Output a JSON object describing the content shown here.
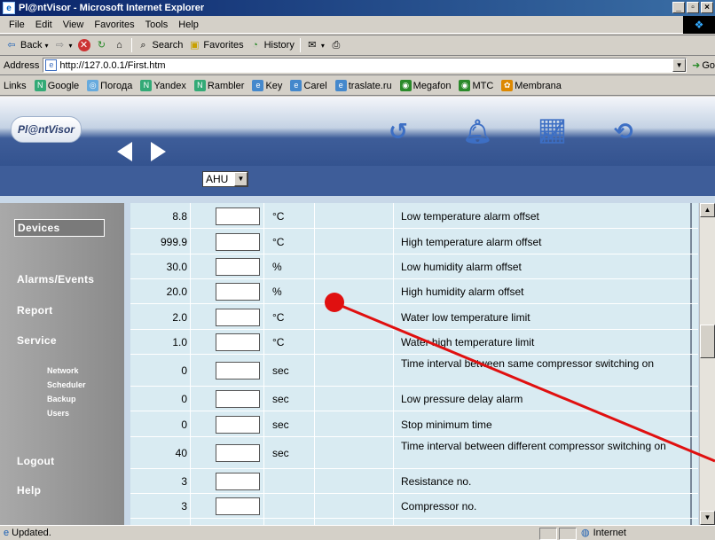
{
  "window": {
    "title": "Pl@ntVisor - Microsoft Internet Explorer"
  },
  "menu": [
    "File",
    "Edit",
    "View",
    "Favorites",
    "Tools",
    "Help"
  ],
  "toolbar": {
    "back": "Back",
    "search": "Search",
    "favorites": "Favorites",
    "history": "History"
  },
  "address": {
    "label": "Address",
    "url": "http://127.0.0.1/First.htm",
    "go": "Go"
  },
  "links": {
    "label": "Links",
    "items": [
      "Google",
      "Погода",
      "Yandex",
      "Rambler",
      "Key",
      "Carel",
      "traslate.ru",
      "Megafon",
      "MTC",
      "Membrana"
    ]
  },
  "plantvisor": {
    "logo": "Pl@ntVisor",
    "device_select": "AHU"
  },
  "sidebar": {
    "items": [
      "Devices",
      "Alarms/Events",
      "Report",
      "Service",
      "Logout",
      "Help"
    ],
    "service_sub": [
      "Network",
      "Scheduler",
      "Backup",
      "Users"
    ]
  },
  "rows": [
    {
      "value": "8.8",
      "unit": "°C",
      "desc": "Low temperature alarm offset"
    },
    {
      "value": "999.9",
      "unit": "°C",
      "desc": "High temperature alarm offset"
    },
    {
      "value": "30.0",
      "unit": "%",
      "desc": "Low humidity alarm offset"
    },
    {
      "value": "20.0",
      "unit": "%",
      "desc": "High humidity alarm offset"
    },
    {
      "value": "2.0",
      "unit": "°C",
      "desc": "Water low temperature limit"
    },
    {
      "value": "1.0",
      "unit": "°C",
      "desc": "Water high temperature limit"
    },
    {
      "value": "0",
      "unit": "sec",
      "desc": "Time interval between same compressor switching on"
    },
    {
      "value": "0",
      "unit": "sec",
      "desc": "Low pressure delay alarm"
    },
    {
      "value": "0",
      "unit": "sec",
      "desc": "Stop minimum time"
    },
    {
      "value": "40",
      "unit": "sec",
      "desc": "Time interval between different compressor switching on"
    },
    {
      "value": "3",
      "unit": "",
      "desc": "Resistance no."
    },
    {
      "value": "3",
      "unit": "",
      "desc": "Compressor no."
    }
  ],
  "status": {
    "text": "Updated.",
    "zone": "Internet"
  },
  "colors": {
    "annotation": "#e01010",
    "title_bar": "#0a246a",
    "header_band": "#34538f"
  }
}
